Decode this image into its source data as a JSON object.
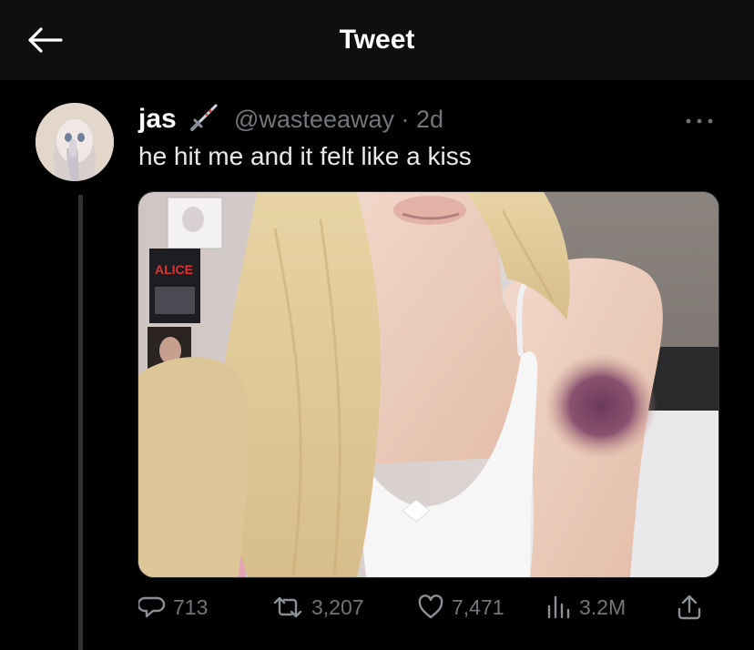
{
  "header": {
    "title": "Tweet",
    "back_icon": "arrow-left-icon"
  },
  "tweet": {
    "author_name": "jas",
    "handle_and_time": "@wasteeaway · 2d",
    "text": "he hit me and it felt like a kiss",
    "name_emoji": "dagger-icon",
    "stats": {
      "replies": "713",
      "retweets": "3,207",
      "likes": "7,471",
      "views": "3.2M"
    }
  },
  "colors": {
    "background": "#000000",
    "topbar": "#0f0f10",
    "text_primary": "#e7e9ea",
    "text_secondary": "#71767b",
    "divider": "#2f3336"
  }
}
